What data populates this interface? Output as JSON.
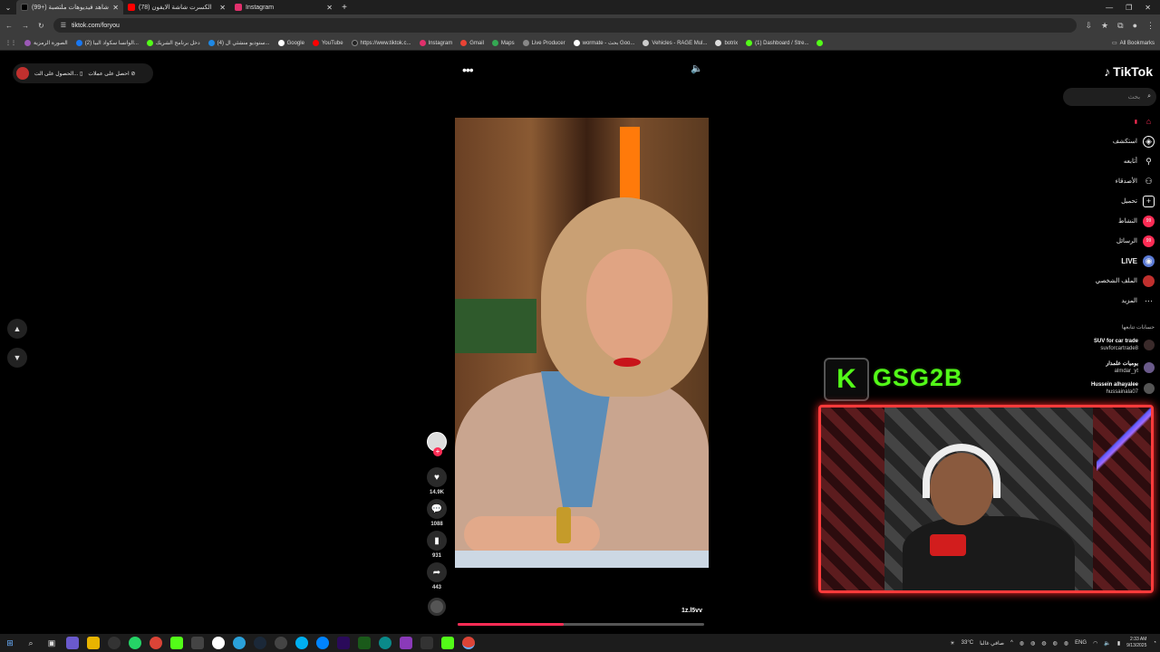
{
  "browser": {
    "tabs": [
      {
        "title": "(99+) شاهد فيديوهات ملتصبة",
        "icon": "tiktok-icon",
        "color": "#111111",
        "active": true
      },
      {
        "title": "(78) الكسرت شاشة الايفون",
        "icon": "youtube-icon",
        "color": "#ff0000",
        "active": false
      },
      {
        "title": "Instagram",
        "icon": "instagram-icon",
        "color": "#e1306c",
        "active": false
      }
    ],
    "url": "tiktok.com/foryou",
    "bookmarks": [
      {
        "label": "الصورة الرمزية",
        "color": "#9b59b6"
      },
      {
        "label": "(2) الوانسا سكواد البيا...",
        "color": "#1877f2"
      },
      {
        "label": "دخل برنامج الشريك",
        "color": "#53fc18"
      },
      {
        "label": "(4) ستوديو منشئي ال...",
        "color": "#1e88e5"
      },
      {
        "label": "Google",
        "color": "#ffffff"
      },
      {
        "label": "YouTube",
        "color": "#ff0000"
      },
      {
        "label": "https://www.tiktok.c...",
        "color": "#222222"
      },
      {
        "label": "Instagram",
        "color": "#e1306c"
      },
      {
        "label": "Gmail",
        "color": "#ea4335"
      },
      {
        "label": "Maps",
        "color": "#34a853"
      },
      {
        "label": "Live Producer",
        "color": "#888888"
      },
      {
        "label": "wormate - بحث Goo...",
        "color": "#ffffff"
      },
      {
        "label": "Vehicles - RAGE Mul...",
        "color": "#cccccc"
      },
      {
        "label": "botrix",
        "color": "#dddddd"
      },
      {
        "label": "(1) Dashboard / Stre...",
        "color": "#53fc18"
      }
    ],
    "all_bookmarks": "All Bookmarks"
  },
  "page": {
    "topleft_items": [
      "احصل على عملات",
      "الحصول على الت..."
    ],
    "timecode": "1z.l5vv",
    "progress_fraction": 0.43,
    "actions": [
      {
        "icon": "heart-icon",
        "count": "14.9K"
      },
      {
        "icon": "comment-icon",
        "count": "1088"
      },
      {
        "icon": "bookmark-icon",
        "count": "931"
      },
      {
        "icon": "share-icon",
        "count": "443"
      }
    ]
  },
  "sidebar": {
    "logo": "TikTok",
    "search_placeholder": "بحث",
    "nav": [
      {
        "label": "",
        "icon": "home-icon",
        "color": "#fe2c55"
      },
      {
        "label": "استكشف",
        "icon": "compass-icon",
        "color": "#ffffff"
      },
      {
        "label": "أتابعه",
        "icon": "following-icon",
        "color": "#ffffff"
      },
      {
        "label": "الأصدقاء",
        "icon": "friends-icon",
        "color": "#ffffff"
      },
      {
        "label": "تحميل",
        "icon": "upload-icon",
        "color": "#ffffff"
      },
      {
        "label": "النشاط",
        "icon": "activity-icon",
        "color": "#fe2c55"
      },
      {
        "label": "الرسائل",
        "icon": "messages-icon",
        "color": "#fe2c55"
      },
      {
        "label": "LIVE",
        "icon": "live-icon",
        "color": "#5b7bd6"
      },
      {
        "label": "الملف الشخصي",
        "icon": "profile-icon",
        "color": "#c0302e"
      },
      {
        "label": "المزيد",
        "icon": "more-icon",
        "color": "#ffffff"
      }
    ],
    "following_header": "حسابات تتابعها",
    "accounts": [
      {
        "name": "SUV for car trade",
        "handle": "suvforcartrade8"
      },
      {
        "name": "يوميات علمدار",
        "handle": "almdar_yt"
      },
      {
        "name": "Hussein alhayalee",
        "handle": "hussainala07"
      }
    ]
  },
  "stream_overlay": {
    "badge_letter": "K",
    "channel_name": "GSG2B",
    "accent": "#53fc18",
    "frame_color": "#ff3b3b"
  },
  "taskbar": {
    "weather": "33°C",
    "weather_text": "صافي غالبا",
    "lang": "ENG",
    "time": "2:33 AM",
    "date": "9/13/2025"
  }
}
